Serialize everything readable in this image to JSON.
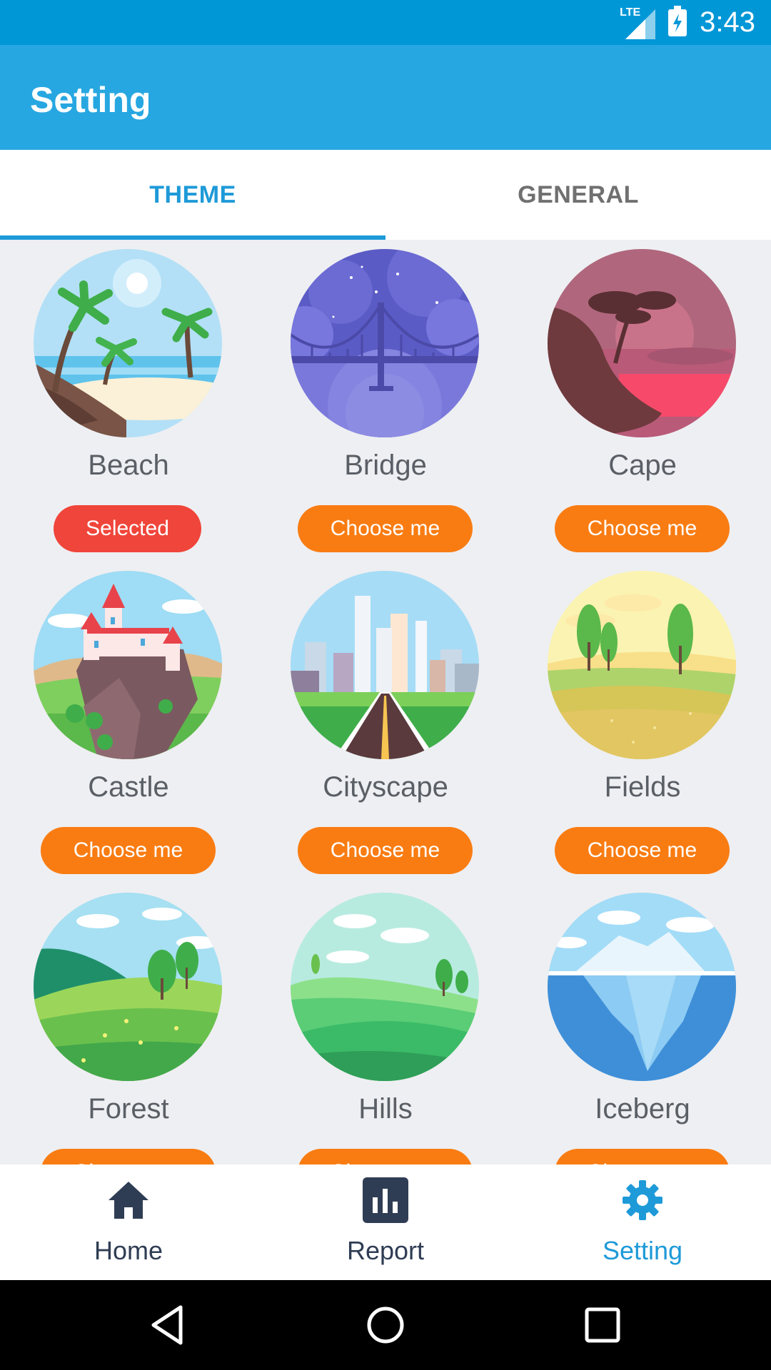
{
  "status_bar": {
    "network": "LTE",
    "time": "3:43"
  },
  "app_bar": {
    "title": "Setting"
  },
  "tabs": [
    {
      "label": "THEME",
      "active": true
    },
    {
      "label": "GENERAL",
      "active": false
    }
  ],
  "themes": [
    {
      "name": "Beach",
      "button": "Selected",
      "selected": true
    },
    {
      "name": "Bridge",
      "button": "Choose me",
      "selected": false
    },
    {
      "name": "Cape",
      "button": "Choose me",
      "selected": false
    },
    {
      "name": "Castle",
      "button": "Choose me",
      "selected": false
    },
    {
      "name": "Cityscape",
      "button": "Choose me",
      "selected": false
    },
    {
      "name": "Fields",
      "button": "Choose me",
      "selected": false
    },
    {
      "name": "Forest",
      "button": "Choose me",
      "selected": false
    },
    {
      "name": "Hills",
      "button": "Choose me",
      "selected": false
    },
    {
      "name": "Iceberg",
      "button": "Choose me",
      "selected": false
    }
  ],
  "bottom_nav": [
    {
      "label": "Home",
      "icon": "home-icon",
      "active": false
    },
    {
      "label": "Report",
      "icon": "bar-chart-icon",
      "active": false
    },
    {
      "label": "Setting",
      "icon": "gear-icon",
      "active": true
    }
  ],
  "colors": {
    "status_bar": "#0097d7",
    "app_bar": "#27a7e1",
    "accent": "#1e9ad8",
    "choose_button": "#f97c12",
    "selected_button": "#f0453a"
  }
}
